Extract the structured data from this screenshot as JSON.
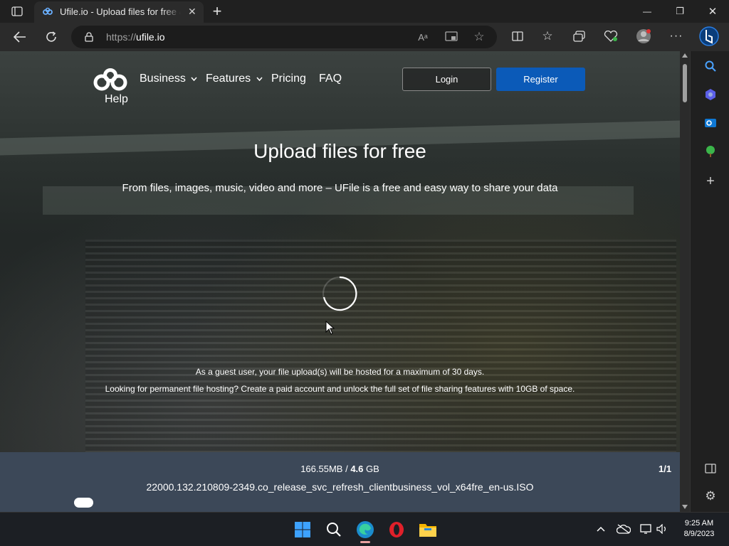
{
  "browser": {
    "tab_title": "Ufile.io - Upload files for free & share them",
    "tab_close": "✕",
    "new_tab": "+",
    "url_scheme": "https://",
    "url_host": "ufile.io",
    "window_controls": {
      "minimize": "—",
      "restore": "❐",
      "close": "✕"
    }
  },
  "site": {
    "logo_label": "Help",
    "nav": [
      {
        "label": "Business",
        "has_dropdown": true
      },
      {
        "label": "Features",
        "has_dropdown": true
      },
      {
        "label": "Pricing",
        "has_dropdown": false
      },
      {
        "label": "FAQ",
        "has_dropdown": false
      }
    ],
    "login_label": "Login",
    "register_label": "Register",
    "hero_title": "Upload files for free",
    "hero_subtitle": "From files, images, music, video and more – UFile is a free and easy way to share your data",
    "guest_note": "As a guest user, your file upload(s) will be hosted for a maximum of 30 days.",
    "paid_note": "Looking for permanent file hosting? Create a paid account and unlock the full set of file sharing features with 10GB of space.",
    "accent_color": "#0b5ab8"
  },
  "upload": {
    "uploaded": "166.55MB",
    "separator": " / ",
    "total_value": "4.6",
    "total_unit": " GB",
    "file_count": "1/1",
    "file_name": "22000.132.210809-2349.co_release_svc_refresh_clientbusiness_vol_x64fre_en-us.ISO"
  },
  "taskbar": {
    "time": "9:25 AM",
    "date": "8/9/2023",
    "apps": [
      "start-icon",
      "search-icon",
      "edge-icon",
      "opera-icon",
      "file-explorer-icon"
    ]
  }
}
